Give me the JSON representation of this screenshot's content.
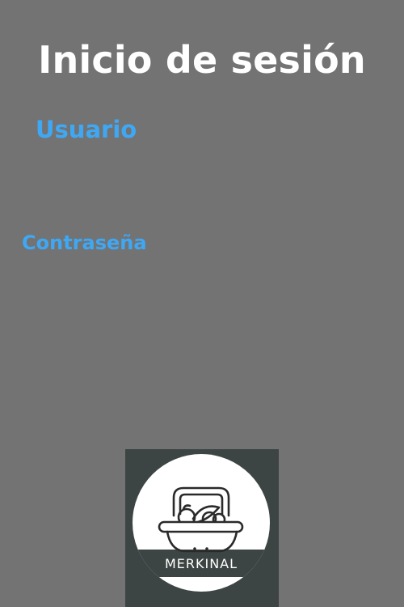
{
  "page": {
    "title": "Inicio de sesión"
  },
  "form": {
    "username_label": "Usuario",
    "password_label": "Contraseña"
  },
  "logo": {
    "brand_name": "MERKINAL",
    "icon": "basket-icon"
  },
  "colors": {
    "background": "#737373",
    "title": "#ffffff",
    "label": "#3ea8f5",
    "logo_background": "#3c4543"
  }
}
